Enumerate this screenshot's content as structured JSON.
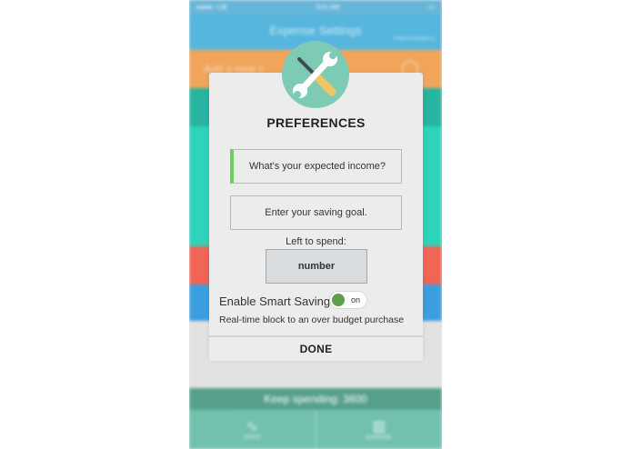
{
  "status_bar": {
    "carrier": "●●●●○ LIB",
    "wifi_icon": "wifi-icon",
    "time": "9:41 AM",
    "battery_icon": "battery-icon"
  },
  "nav": {
    "title": "Expense Settings",
    "right_label": "PREFERENCES"
  },
  "background_rows": {
    "add_row_text": "Add a new c",
    "add_icon": "plus-circle-icon"
  },
  "keep_spending": {
    "label": "Keep spending:",
    "value": "3600"
  },
  "tabs": [
    {
      "label": "STATS",
      "icon": "stats-icon"
    },
    {
      "label": "EXPENSE",
      "icon": "expense-icon"
    }
  ],
  "modal": {
    "icon": "tools-icon",
    "title": "PREFERENCES",
    "income_placeholder": "What's your expected income?",
    "saving_goal_placeholder": "Enter your saving goal.",
    "left_to_spend_label": "Left to spend:",
    "left_to_spend_value": "number",
    "smart_saving_label": "Enable Smart Saving",
    "smart_saving_state": "on",
    "smart_saving_enabled": true,
    "smart_saving_description": "Real-time block to an over budget purchase",
    "done_label": "DONE"
  },
  "colors": {
    "status_blue": "#47a9d5",
    "nav_blue": "#56b6de",
    "orange": "#f1a55b",
    "teal": "#2ed3b9",
    "red": "#f06555",
    "blue": "#3b9ee0",
    "keep_green": "#4f9c86",
    "tab_green": "#71c1ae",
    "badge_green": "#7ecbb5",
    "income_accent": "#6bcf5c",
    "toggle_knob": "#5d9e4f",
    "modal_bg": "#ececec"
  }
}
